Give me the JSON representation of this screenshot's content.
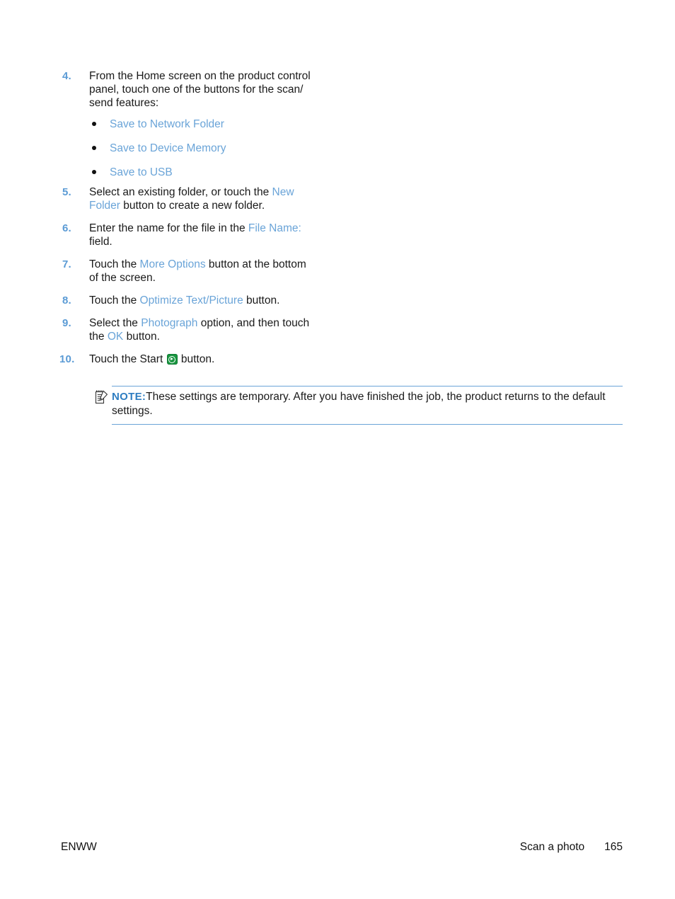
{
  "document": {
    "type": "printed-manual-page",
    "accent_color": "#6aa4d8",
    "step_number_color": "#5b9bd5",
    "body_text_color": "#1a1a1a"
  },
  "steps": [
    {
      "number": "4.",
      "segments": [
        {
          "text": "From the Home screen on the product control panel, touch one of the buttons for the scan/send features:",
          "style": "plain"
        }
      ]
    },
    {
      "number": "5.",
      "segments": [
        {
          "text": "Select an existing folder, or touch the ",
          "style": "plain"
        },
        {
          "text": "New Folder",
          "style": "link"
        },
        {
          "text": " button to create a new folder.",
          "style": "plain"
        }
      ]
    },
    {
      "number": "6.",
      "segments": [
        {
          "text": "Enter the name for the file in the ",
          "style": "plain"
        },
        {
          "text": "File Name:",
          "style": "link"
        },
        {
          "text": " field.",
          "style": "plain"
        }
      ]
    },
    {
      "number": "7.",
      "segments": [
        {
          "text": "Touch the ",
          "style": "plain"
        },
        {
          "text": "More Options",
          "style": "link"
        },
        {
          "text": " button at the bottom of the screen.",
          "style": "plain"
        }
      ]
    },
    {
      "number": "8.",
      "segments": [
        {
          "text": "Touch the ",
          "style": "plain"
        },
        {
          "text": "Optimize Text/Picture",
          "style": "link"
        },
        {
          "text": " button.",
          "style": "plain"
        }
      ]
    },
    {
      "number": "9.",
      "segments": [
        {
          "text": "Select the ",
          "style": "plain"
        },
        {
          "text": "Photograph",
          "style": "link"
        },
        {
          "text": " option, and then touch the ",
          "style": "plain"
        },
        {
          "text": "OK",
          "style": "link"
        },
        {
          "text": " button.",
          "style": "plain"
        }
      ]
    },
    {
      "number": "10.",
      "segments": [
        {
          "text": "Touch the Start ",
          "style": "plain"
        },
        {
          "text": "start-button-icon",
          "style": "icon"
        },
        {
          "text": " button.",
          "style": "plain"
        }
      ]
    }
  ],
  "step4_text": {
    "line1": "From the Home screen on the product control",
    "line2": "panel, touch one of the buttons for the scan/",
    "line3": "send features:"
  },
  "step5_text": {
    "prefix": "Select an existing folder, or touch the ",
    "link": "New Folder",
    "suffix": " button to create a new folder."
  },
  "step6_text": {
    "prefix": "Enter the name for the file in the ",
    "link": "File Name:",
    "suffix": " field."
  },
  "step7_text": {
    "prefix": "Touch the ",
    "link": "More Options",
    "suffix": " button at the bottom of the screen."
  },
  "step8_text": {
    "prefix": "Touch the ",
    "link": "Optimize Text/Picture",
    "suffix": " button."
  },
  "step9_text": {
    "prefix": "Select the ",
    "link1": "Photograph",
    "middle": " option, and then touch the ",
    "link2": "OK",
    "suffix": " button."
  },
  "step10_text": {
    "prefix": "Touch the Start ",
    "suffix": " button."
  },
  "step_numbers": {
    "s4": "4.",
    "s5": "5.",
    "s6": "6.",
    "s7": "7.",
    "s8": "8.",
    "s9": "9.",
    "s10": "10."
  },
  "bullets": [
    {
      "label": "Save to Network Folder"
    },
    {
      "label": "Save to Device Memory"
    },
    {
      "label": "Save to USB"
    }
  ],
  "note": {
    "icon": "note-pencil-icon",
    "label": "NOTE:",
    "text": "These settings are temporary. After you have finished the job, the product returns to the default settings."
  },
  "footer": {
    "left": "ENWW",
    "chapter": "Scan a photo",
    "page_number": "165"
  }
}
